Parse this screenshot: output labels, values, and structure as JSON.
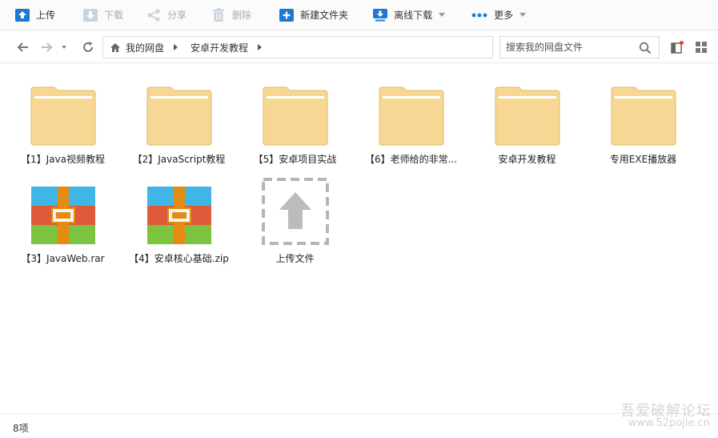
{
  "toolbar": {
    "upload": "上传",
    "download": "下载",
    "share": "分享",
    "delete": "删除",
    "new_folder": "新建文件夹",
    "offline_download": "离线下载",
    "more": "更多"
  },
  "breadcrumb": {
    "root": "我的网盘",
    "current": "安卓开发教程"
  },
  "search": {
    "placeholder": "搜索我的网盘文件"
  },
  "items": [
    {
      "name": "【1】Java视频教程",
      "type": "folder"
    },
    {
      "name": "【2】JavaScript教程",
      "type": "folder"
    },
    {
      "name": "【5】安卓项目实战",
      "type": "folder"
    },
    {
      "name": "【6】老师给的非常...",
      "type": "folder"
    },
    {
      "name": "安卓开发教程",
      "type": "folder"
    },
    {
      "name": "专用EXE播放器",
      "type": "folder"
    },
    {
      "name": "【3】JavaWeb.rar",
      "type": "archive"
    },
    {
      "name": "【4】安卓核心基础.zip",
      "type": "archive"
    },
    {
      "name": "上传文件",
      "type": "upload-placeholder"
    }
  ],
  "status": {
    "count": "8项"
  },
  "watermark": {
    "text": "吾爱破解论坛",
    "sub": "www.52pojie.cn"
  },
  "colors": {
    "accent": "#1e78d0",
    "folder_fill": "#f6d794",
    "folder_edge": "#e3b865",
    "notification_dot": "#e8402a"
  }
}
